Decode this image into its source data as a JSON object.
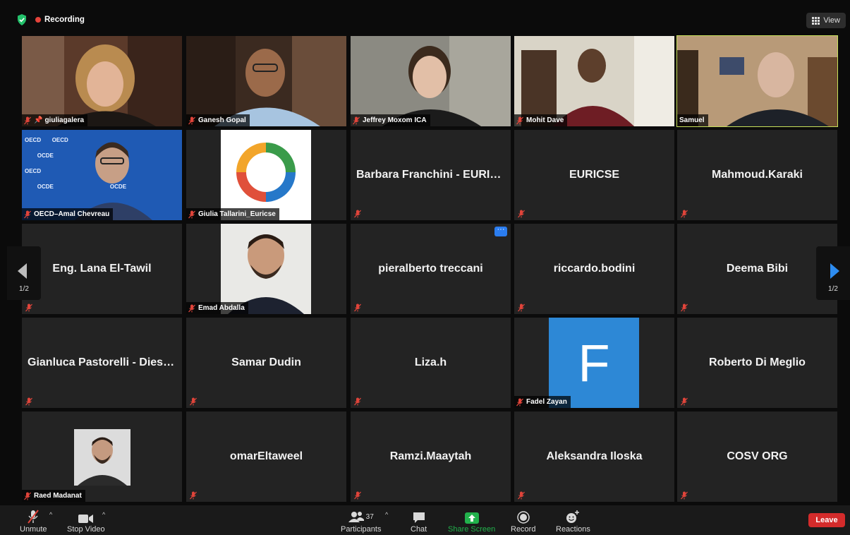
{
  "topbar": {
    "recording_label": "Recording",
    "view_label": "View"
  },
  "pager": {
    "left": "1/2",
    "right": "1/2"
  },
  "tiles": [
    {
      "name": "giuliagalera"
    },
    {
      "name": "Ganesh Gopal"
    },
    {
      "name": "Jeffrey Moxom ICA"
    },
    {
      "name": "Mohit Dave"
    },
    {
      "name": "Samuel"
    },
    {
      "name": "OECD–Amal Chevreau"
    },
    {
      "name": "Giulia Tallarini_Euricse"
    },
    {
      "name": "Barbara Franchini - EURICSE"
    },
    {
      "name": "EURICSE"
    },
    {
      "name": "Mahmoud.Karaki"
    },
    {
      "name": "Eng. Lana El-Tawil"
    },
    {
      "name": "Emad Abdalla"
    },
    {
      "name": "pieralberto treccani"
    },
    {
      "name": "riccardo.bodini"
    },
    {
      "name": "Deema Bibi"
    },
    {
      "name": "Gianluca Pastorelli - Diesis..."
    },
    {
      "name": "Samar Dudin"
    },
    {
      "name": "Liza.h"
    },
    {
      "name": "Fadel Zayan",
      "initial": "F"
    },
    {
      "name": "Roberto Di Meglio"
    },
    {
      "name": "Raed Madanat"
    },
    {
      "name": "omarEltaweel"
    },
    {
      "name": "Ramzi.Maaytah"
    },
    {
      "name": "Aleksandra Iloska"
    },
    {
      "name": "COSV ORG"
    }
  ],
  "oecd_logo_text": "OECD",
  "ocde_logo_text": "OCDE",
  "toolbar": {
    "unmute": "Unmute",
    "stop_video": "Stop Video",
    "participants": "Participants",
    "participants_count": "37",
    "chat": "Chat",
    "share_screen": "Share Screen",
    "record": "Record",
    "reactions": "Reactions",
    "leave": "Leave"
  },
  "colors": {
    "highlight": "#c7e05a",
    "recording": "#e5433b",
    "leave": "#d42b2b",
    "share_green": "#22b14c",
    "avatar_blue": "#2d88d6",
    "arrow_blue": "#2d8cf0"
  }
}
